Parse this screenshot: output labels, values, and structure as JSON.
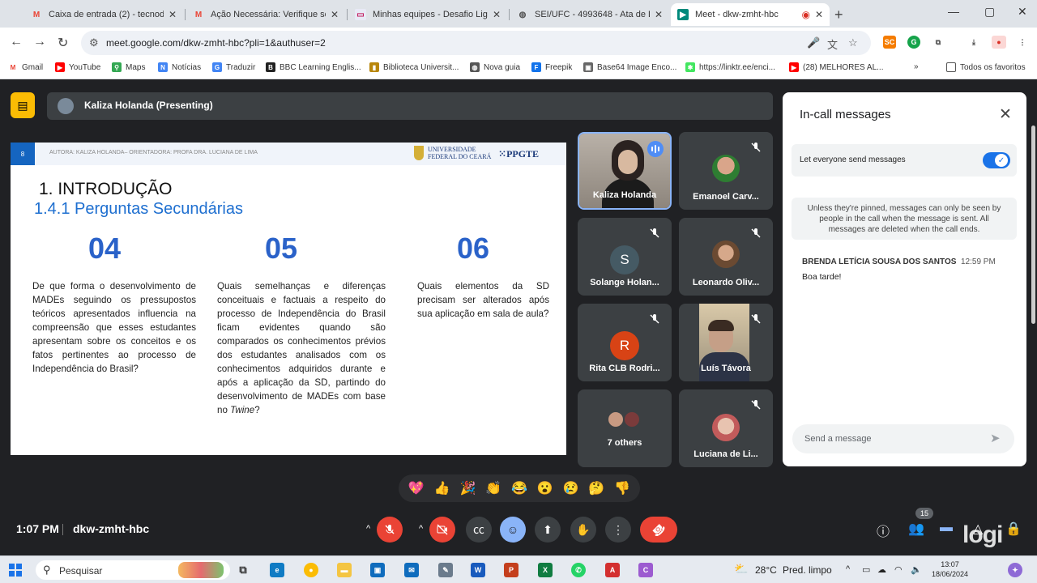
{
  "browser": {
    "tabs": [
      {
        "title": "Caixa de entrada (2) - tecnodo",
        "icon": "gmail-icon",
        "active": false
      },
      {
        "title": "Ação Necessária: Verifique se su",
        "icon": "gmail-icon",
        "active": false
      },
      {
        "title": "Minhas equipes - Desafio Liga /",
        "icon": "liga-icon",
        "active": false
      },
      {
        "title": "SEI/UFC - 4993648 - Ata de Def",
        "icon": "sei-icon",
        "active": false
      },
      {
        "title": "Meet - dkw-zmht-hbc",
        "icon": "meet-icon",
        "active": true
      }
    ],
    "url": "meet.google.com/dkw-zmht-hbc?pli=1&authuser=2",
    "bookmarks": [
      "Gmail",
      "YouTube",
      "Maps",
      "Notícias",
      "Traduzir",
      "BBC Learning Englis...",
      "Biblioteca Universit...",
      "Nova guia",
      "Freepik",
      "Base64 Image Enco...",
      "https://linktr.ee/enci...",
      "(28) MELHORES AL...",
      "Todos os favoritos"
    ]
  },
  "meet": {
    "presenter_label": "Kaliza Holanda (Presenting)",
    "time": "1:07 PM",
    "meeting_code": "dkw-zmht-hbc",
    "participant_count": "15",
    "overlay_text": "logi",
    "reactions": [
      "💖",
      "👍",
      "🎉",
      "👏",
      "😂",
      "😮",
      "😢",
      "🤔",
      "👎"
    ]
  },
  "slide": {
    "number": "8",
    "author": "AUTORA: KALIZA HOLANDA– ORIENTADORA: PROFA DRA. LUCIANA DE LIMA",
    "logo_line1": "UNIVERSIDADE",
    "logo_line2": "FEDERAL DO CEARÁ",
    "logo_ppgte": "PPGTE",
    "title": "1.   INTRODUÇÃO",
    "subtitle": "1.4.1 Perguntas Secundárias",
    "columns": [
      {
        "number": "04",
        "text": "De que forma o desenvolvimento de MADEs seguindo os pressupostos teóricos apresentados influencia na compreensão que esses estudantes apresentam sobre os conceitos e os fatos pertinentes ao processo de Independência do Brasil?"
      },
      {
        "number": "05",
        "text_before": "Quais semelhanças e diferenças conceituais e factuais a respeito do processo de Independência do Brasil ficam evidentes quando são comparados os conhecimentos prévios dos estudantes analisados com os conhecimentos adquiridos durante e após a aplicação da SD, partindo do desenvolvimento de MADEs com base no ",
        "text_italic": "Twine",
        "text_after": "?"
      },
      {
        "number": "06",
        "text": "Quais elementos da SD precisam ser alterados após sua aplicação em sala de aula?"
      }
    ]
  },
  "participants": [
    {
      "name": "Kaliza Holanda",
      "speaking": true
    },
    {
      "name": "Emanoel Carv...",
      "muted": true
    },
    {
      "name": "Solange Holan...",
      "letter": "S",
      "muted": true
    },
    {
      "name": "Leonardo Oliv...",
      "muted": true
    },
    {
      "name": "Rita CLB Rodri...",
      "letter": "R",
      "muted": true
    },
    {
      "name": "Luís Távora",
      "muted": true
    },
    {
      "name": "7 others"
    },
    {
      "name": "Luciana de Li...",
      "muted": true
    }
  ],
  "chat": {
    "title": "In-call messages",
    "permission_label": "Let everyone send messages",
    "permission_on": true,
    "notice": "Unless they're pinned, messages can only be seen by people in the call when the message is sent. All messages are deleted when the call ends.",
    "messages": [
      {
        "sender": "BRENDA LETÍCIA SOUSA DOS SANTOS",
        "time": "12:59 PM",
        "text": "Boa tarde!"
      }
    ],
    "input_placeholder": "Send a message"
  },
  "taskbar": {
    "search_label": "Pesquisar",
    "weather_temp": "28°C",
    "weather_text": "Pred. limpo",
    "clock_time": "13:07",
    "clock_date": "18/06/2024"
  },
  "colors": {
    "meet_bg": "#202124",
    "tile_bg": "#3c4043",
    "end_call_red": "#ea4335",
    "accent_blue": "#8ab4f8",
    "slide_blue": "#2a62c9",
    "presenter_yellow": "#fbbc04"
  }
}
